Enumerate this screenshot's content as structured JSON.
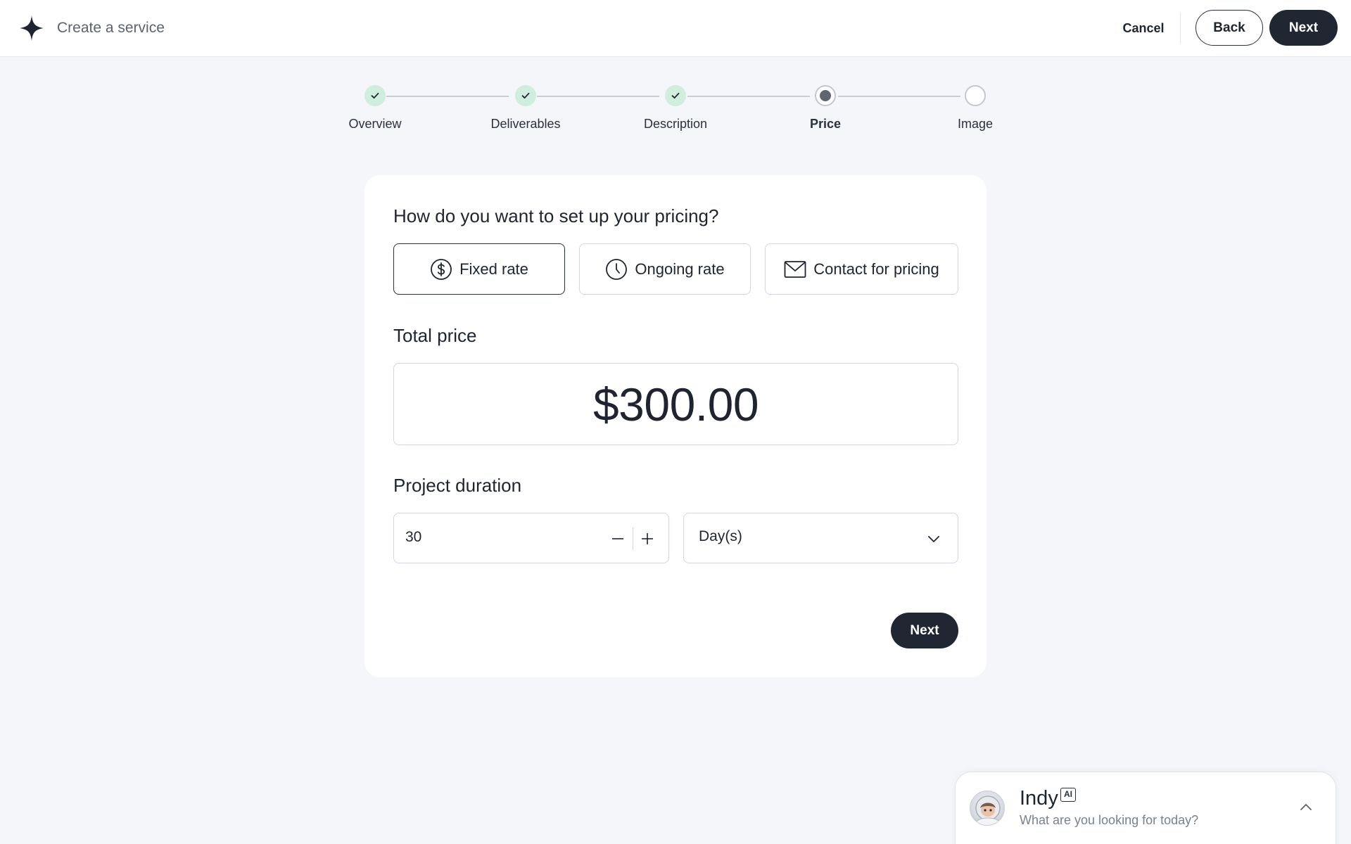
{
  "header": {
    "title": "Create a service",
    "cancel_label": "Cancel",
    "back_label": "Back",
    "next_label": "Next"
  },
  "steps": [
    {
      "label": "Overview",
      "status": "done"
    },
    {
      "label": "Deliverables",
      "status": "done"
    },
    {
      "label": "Description",
      "status": "done"
    },
    {
      "label": "Price",
      "status": "current"
    },
    {
      "label": "Image",
      "status": "todo"
    }
  ],
  "pricing": {
    "question": "How do you want to set up your pricing?",
    "options": [
      {
        "label": "Fixed rate",
        "icon": "dollar-circle-icon",
        "selected": true
      },
      {
        "label": "Ongoing rate",
        "icon": "clock-icon",
        "selected": false
      },
      {
        "label": "Contact for pricing",
        "icon": "envelope-icon",
        "selected": false
      }
    ],
    "total_price_label": "Total price",
    "total_price_value": "$300.00",
    "duration_label": "Project duration",
    "duration_value": "30",
    "duration_unit": "Day(s)",
    "next_label": "Next"
  },
  "assistant": {
    "name": "Indy",
    "badge": "AI",
    "prompt": "What are you looking for today?"
  },
  "colors": {
    "primary_dark": "#212633",
    "background": "#f4f6f9",
    "step_done": "#cfeedd",
    "step_check": "#1f2430",
    "border": "#d3d7dd"
  }
}
